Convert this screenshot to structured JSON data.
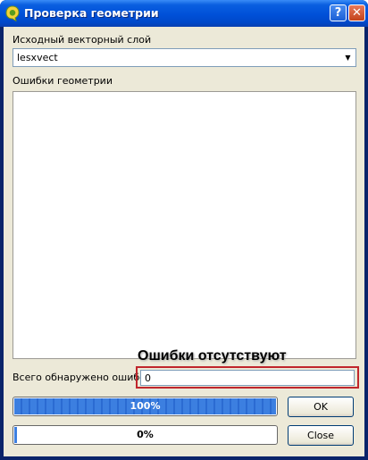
{
  "window": {
    "title": "Проверка геометрии",
    "help_glyph": "?",
    "close_glyph": "✕"
  },
  "form": {
    "source_layer_label": "Исходный векторный слой",
    "source_layer_value": "lesxvect",
    "errors_label": "Ошибки геометрии",
    "total_errors_label": "Всего обнаружено ошибок",
    "total_errors_value": "0"
  },
  "annotation": {
    "text": "Ошибки отсутствуют",
    "color": "#c0262c"
  },
  "progress": [
    {
      "label": "100%",
      "value": 1.0
    },
    {
      "label": "0%",
      "value": 0.0
    }
  ],
  "buttons": {
    "ok": "OK",
    "close": "Close"
  },
  "colors": {
    "title_bar": "#0054e3",
    "progress_fill": "#3c7fe0"
  },
  "icons": {
    "app": "qgis-icon",
    "combo_arrow": "chevron-down-icon"
  }
}
